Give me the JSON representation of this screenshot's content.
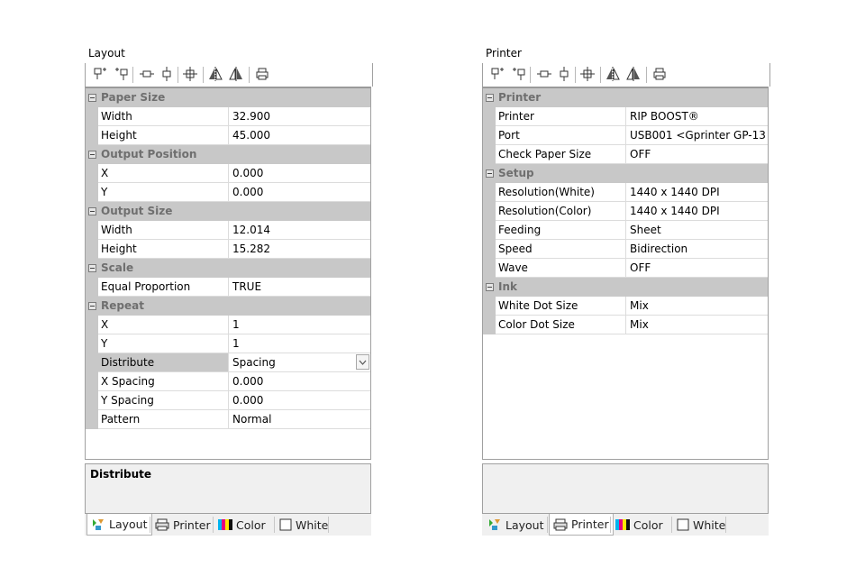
{
  "layout": {
    "title": "Layout",
    "categories": [
      {
        "name": "Paper Size",
        "rows": [
          [
            "Width",
            "32.900"
          ],
          [
            "Height",
            "45.000"
          ]
        ]
      },
      {
        "name": "Output Position",
        "rows": [
          [
            "X",
            "0.000"
          ],
          [
            "Y",
            "0.000"
          ]
        ]
      },
      {
        "name": "Output Size",
        "rows": [
          [
            "Width",
            "12.014"
          ],
          [
            "Height",
            "15.282"
          ]
        ]
      },
      {
        "name": "Scale",
        "rows": [
          [
            "Equal Proportion",
            "TRUE"
          ]
        ]
      },
      {
        "name": "Repeat",
        "rows": [
          [
            "X",
            "1"
          ],
          [
            "Y",
            "1"
          ],
          [
            "Distribute",
            "Spacing"
          ],
          [
            "X Spacing",
            "0.000"
          ],
          [
            "Y Spacing",
            "0.000"
          ],
          [
            "Pattern",
            "Normal"
          ]
        ]
      }
    ],
    "selected_row": "Distribute",
    "description_title": "Distribute",
    "active_tab": 0
  },
  "printer": {
    "title": "Printer",
    "categories": [
      {
        "name": "Printer",
        "rows": [
          [
            "Printer",
            "RIP BOOST®"
          ],
          [
            "Port",
            "USB001  <Gprinter  GP-13"
          ],
          [
            "Check Paper Size",
            "OFF"
          ]
        ]
      },
      {
        "name": "Setup",
        "rows": [
          [
            "Resolution(White)",
            "1440 x 1440 DPI"
          ],
          [
            "Resolution(Color)",
            "1440 x 1440 DPI"
          ],
          [
            "Feeding",
            "Sheet"
          ],
          [
            "Speed",
            "Bidirection"
          ],
          [
            "Wave",
            "OFF"
          ]
        ]
      },
      {
        "name": "Ink",
        "rows": [
          [
            "White Dot Size",
            "Mix"
          ],
          [
            "Color Dot Size",
            "Mix"
          ]
        ]
      }
    ],
    "description_title": "",
    "active_tab": 1
  },
  "tabs": [
    {
      "label": "Layout",
      "icon": "layout-icon"
    },
    {
      "label": "Printer",
      "icon": "printer-icon"
    },
    {
      "label": "Color",
      "icon": "color-icon"
    },
    {
      "label": "White",
      "icon": "white-icon"
    }
  ],
  "toolbar_icons": [
    "align-top-left-icon",
    "align-top-right-icon",
    "center-horizontal-icon",
    "center-vertical-icon",
    "center-both-icon",
    "flip-horizontal-icon",
    "flip-vertical-icon",
    "print-icon"
  ],
  "colors": {
    "category_bg": "#c8c8c8",
    "category_text": "#6f6f6f",
    "border": "#a0a0a0"
  }
}
